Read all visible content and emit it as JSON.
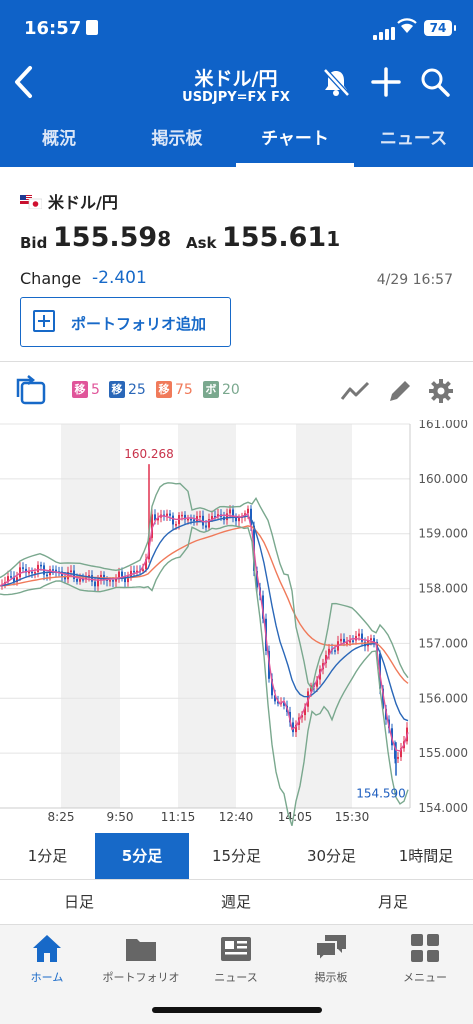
{
  "status_bar": {
    "time": "16:57",
    "battery": "74"
  },
  "header": {
    "title": "米ドル/円",
    "subtitle": "USDJPY=FX FX",
    "icons": [
      "back-icon",
      "bell-off-icon",
      "plus-icon",
      "search-icon"
    ]
  },
  "tabs": [
    {
      "label": "概況"
    },
    {
      "label": "掲示板"
    },
    {
      "label": "チャート"
    },
    {
      "label": "ニュース"
    }
  ],
  "active_tab": "チャート",
  "quote": {
    "pair": "米ドル/円",
    "bid_label": "Bid",
    "bid_main": "155.59",
    "bid_last": "8",
    "ask_label": "Ask",
    "ask_main": "155.61",
    "ask_last": "1",
    "change_label": "Change",
    "change_value": "-2.401",
    "timestamp": "4/29 16:57",
    "portfolio_button": "ポートフォリオ追加"
  },
  "indicators": [
    {
      "chip": "移",
      "value": "5",
      "color": "#e0559a"
    },
    {
      "chip": "移",
      "value": "25",
      "color": "#2a67b8"
    },
    {
      "chip": "移",
      "value": "75",
      "color": "#f07a5a"
    },
    {
      "chip": "ボ",
      "value": "20",
      "color": "#7aa88e"
    }
  ],
  "chart_data": {
    "type": "candlestick",
    "y_ticks": [
      "161.000",
      "160.000",
      "159.000",
      "158.000",
      "157.000",
      "156.000",
      "155.000",
      "154.000"
    ],
    "ylim": [
      154.0,
      161.0
    ],
    "x_ticks": [
      "8:25",
      "9:50",
      "11:15",
      "12:40",
      "14:05",
      "15:30"
    ],
    "annotations": {
      "high": "160.268",
      "low": "154.590"
    },
    "series": [
      {
        "name": "移5",
        "color": "#e0559a"
      },
      {
        "name": "移25",
        "color": "#2a67b8"
      },
      {
        "name": "移75",
        "color": "#f07a5a"
      },
      {
        "name": "ボ20",
        "color": "#7aa88e"
      }
    ]
  },
  "timeframes": [
    {
      "label": "1分足"
    },
    {
      "label": "5分足"
    },
    {
      "label": "15分足"
    },
    {
      "label": "30分足"
    },
    {
      "label": "1時間足"
    }
  ],
  "active_timeframe": "5分足",
  "timeframes_row2": [
    {
      "label": "日足"
    },
    {
      "label": "週足"
    },
    {
      "label": "月足"
    }
  ],
  "bottom_nav": [
    {
      "label": "ホーム",
      "icon": "home-icon"
    },
    {
      "label": "ポートフォリオ",
      "icon": "folder-icon"
    },
    {
      "label": "ニュース",
      "icon": "news-icon"
    },
    {
      "label": "掲示板",
      "icon": "chat-icon"
    },
    {
      "label": "メニュー",
      "icon": "grid-icon"
    }
  ]
}
